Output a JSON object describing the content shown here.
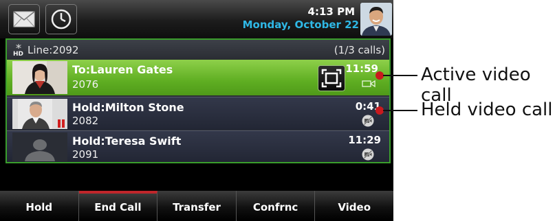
{
  "status": {
    "time": "4:13 PM",
    "date": "Monday, October 22"
  },
  "line": {
    "label": "Line:2092",
    "calls_count": "(1/3 calls)"
  },
  "calls": [
    {
      "name": "To:Lauren Gates",
      "number": "2076",
      "timer": "11:59"
    },
    {
      "name": "Hold:Milton Stone",
      "number": "2082",
      "timer": "0:41"
    },
    {
      "name": "Hold:Teresa Swift",
      "number": "2091",
      "timer": "11:29"
    }
  ],
  "softkeys": [
    "Hold",
    "End Call",
    "Transfer",
    "Confrnc",
    "Video"
  ],
  "callouts": {
    "active": "Active video call",
    "held": "Held video call"
  },
  "colors": {
    "active_row": "#5fae22",
    "date_blue": "#2fb8e6",
    "line_border": "#3a9e2c",
    "end_call_accent": "#c0262b",
    "callout_dot": "#c9191e"
  },
  "icons": [
    "envelope-icon",
    "clock-icon",
    "hd-icon",
    "fullscreen-icon",
    "camera-icon",
    "video-off-icon"
  ]
}
